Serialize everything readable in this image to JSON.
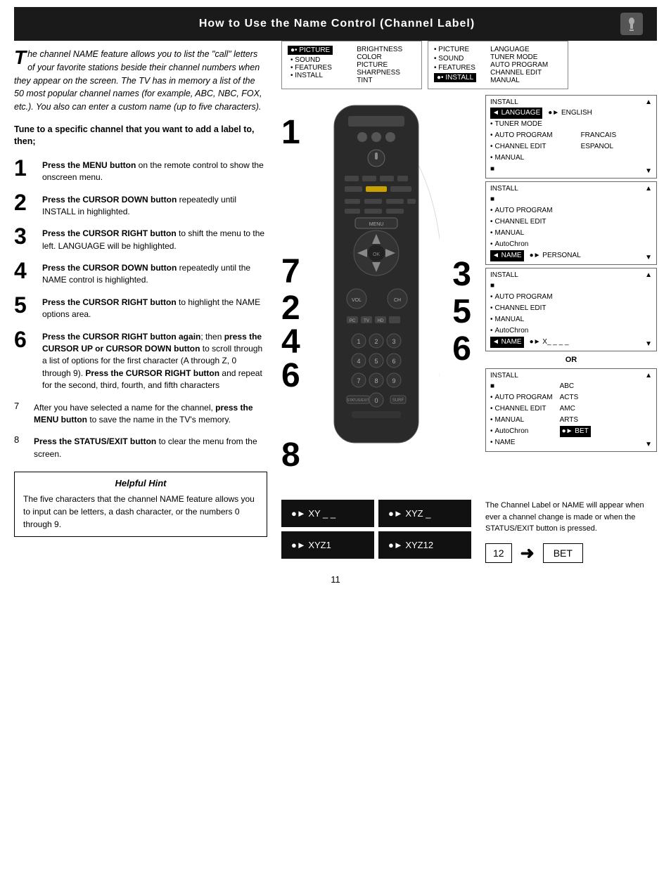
{
  "header": {
    "title": "How to Use the Name Control (Channel Label)"
  },
  "intro": {
    "text": "he channel NAME feature allows you to list the \"call\" letters of your favorite stations beside their channel numbers when they appear on the screen.  The TV has in memory a list of the 50 most popular channel names (for example, ABC, NBC, FOX, etc.).  You also can enter a custom name (up to five characters).",
    "first_letter": "T"
  },
  "tune_heading": "Tune to a specific channel that you want to add a label to, then;",
  "steps": [
    {
      "number": "1",
      "text": "Press the MENU button on the remote control to show the onscreen menu.",
      "bold_part": "Press the MENU button"
    },
    {
      "number": "2",
      "text": "Press the CURSOR DOWN button repeatedly until INSTALL in highlighted.",
      "bold_part": "Press the CURSOR DOWN button"
    },
    {
      "number": "3",
      "text": "Press the CURSOR RIGHT button to shift the menu to the left. LANGUAGE will be highlighted.",
      "bold_part": "Press the CURSOR RIGHT button"
    },
    {
      "number": "4",
      "text": "Press the CURSOR DOWN button repeatedly until the NAME control is highlighted.",
      "bold_part": "Press the CURSOR DOWN button"
    },
    {
      "number": "5",
      "text": "Press the CURSOR RIGHT button to highlight the NAME options area.",
      "bold_part": "Press the CURSOR RIGHT button"
    },
    {
      "number": "6",
      "text": "Press the CURSOR RIGHT button again; then press the CURSOR UP or CURSOR DOWN button to scroll through a list of options for the first character (A through Z, 0 through 9). Press the CURSOR RIGHT button and repeat for the second, third, fourth, and fifth characters",
      "bold_parts": [
        "Press the CURSOR RIGHT button",
        "press the CURSOR UP or CURSOR DOWN button",
        "Press the CURSOR RIGHT button"
      ]
    },
    {
      "number": "7",
      "small": true,
      "text": "After you have selected a name for the channel, press the MENU button to save the name in the TV's memory.",
      "bold_part": "press the MENU button"
    },
    {
      "number": "8",
      "small": true,
      "text": "Press the STATUS/EXIT button to clear the menu from the screen.",
      "bold_part": "Press the STATUS/EXIT button"
    }
  ],
  "hint": {
    "title": "Helpful Hint",
    "text": "The five characters that the channel NAME feature allows you to input can be letters, a dash character, or the numbers 0 through 9."
  },
  "menus": {
    "panel1_title": "INSTALL",
    "panel1_items": [
      "■",
      "• AUTO PROGRAM",
      "• CHANNEL EDIT",
      "• MANUAL",
      "• AutoChron",
      "◄ NAME"
    ],
    "panel1_value": "●► PERSONAL",
    "panel2_title": "INSTALL",
    "panel2_items": [
      "■",
      "• AUTO PROGRAM",
      "• CHANNEL EDIT",
      "• MANUAL",
      "• AutoChron",
      "◄ NAME"
    ],
    "panel2_value": "●► X_ _ _ _",
    "or_label": "OR",
    "panel3_title": "INSTALL",
    "panel3_items": [
      "■",
      "• AUTO PROGRAM",
      "• CHANNEL EDIT",
      "• MANUAL",
      "• AutoChron",
      "• NAME"
    ],
    "panel3_options": [
      "ABC",
      "ACTS",
      "AMC",
      "ARTS",
      "●► BET"
    ]
  },
  "first_menu": {
    "items": [
      "●• PICTURE",
      "• SOUND",
      "• FEATURES",
      "• INSTALL"
    ],
    "values": [
      "BRIGHTNESS",
      "COLOR",
      "PICTURE",
      "SHARPNESS",
      "TINT"
    ]
  },
  "second_menu": {
    "items": [
      "• PICTURE",
      "• SOUND",
      "• FEATURES",
      "●• INSTALL"
    ],
    "values": [
      "LANGUAGE",
      "TUNER MODE",
      "AUTO PROGRAM",
      "CHANNEL EDIT",
      "MANUAL"
    ]
  },
  "third_menu": {
    "title": "INSTALL",
    "items": [
      "◄ LANGUAGE",
      "• TUNER MODE",
      "• AUTO PROGRAM",
      "• CHANNEL EDIT",
      "• MANUAL",
      "■"
    ],
    "values": [
      "●► ENGLISH",
      "FRANCAIS",
      "ESPANOL"
    ],
    "up_arrow": "▲",
    "down_arrow": "▼"
  },
  "screens": [
    {
      "text": "●► XY _ _"
    },
    {
      "text": "●► XYZ _"
    },
    {
      "text": "●► XYZ1"
    },
    {
      "text": "●► XYZ12"
    }
  ],
  "bottom_caption": "The Channel Label or NAME will appear when ever a channel change is made or when the STATUS/EXIT button is pressed.",
  "channel_display": {
    "channel": "12",
    "label": "BET"
  },
  "remote_steps": {
    "step_1_7": "17",
    "step_2_4_6": "246",
    "step_3_5_6": "356",
    "step_8": "8"
  },
  "page_number": "11"
}
